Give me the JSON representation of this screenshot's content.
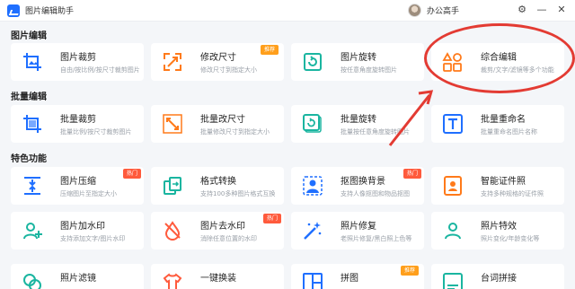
{
  "app": {
    "title": "图片编辑助手",
    "user_name": "办公高手"
  },
  "window": {
    "settings": "⚙",
    "minimize": "—",
    "close": "✕"
  },
  "sections": {
    "edit": "图片编辑",
    "batch": "批量编辑",
    "features": "特色功能"
  },
  "cards": {
    "crop": {
      "name": "图片裁剪",
      "desc": "自由/按比例/按尺寸裁剪图片"
    },
    "resize": {
      "name": "修改尺寸",
      "desc": "修改尺寸到指定大小",
      "badge": "推荐"
    },
    "rotate": {
      "name": "图片旋转",
      "desc": "按任意角度旋转图片"
    },
    "combo": {
      "name": "综合编辑",
      "desc": "裁剪/文字/滤镜等多个功能"
    },
    "batch_crop": {
      "name": "批量裁剪",
      "desc": "批量比例/按尺寸裁剪图片"
    },
    "batch_resize": {
      "name": "批量改尺寸",
      "desc": "批量修改尺寸到指定大小"
    },
    "batch_rotate": {
      "name": "批量旋转",
      "desc": "批量按任意角度旋转图片"
    },
    "batch_rename": {
      "name": "批量重命名",
      "desc": "批量重命名图片名称"
    },
    "compress": {
      "name": "图片压缩",
      "desc": "压缩图片至指定大小",
      "badge": "热门"
    },
    "format": {
      "name": "格式转换",
      "desc": "支持100多种图片格式互换"
    },
    "cutout": {
      "name": "抠图换背景",
      "desc": "支持人像抠图和物品抠图",
      "badge": "热门"
    },
    "id_photo": {
      "name": "智能证件照",
      "desc": "支持多种规格的证件照"
    },
    "watermark_add": {
      "name": "图片加水印",
      "desc": "支持添加文字/图片水印"
    },
    "watermark_remove": {
      "name": "图片去水印",
      "desc": "消除任意位置的水印",
      "badge": "热门"
    },
    "repair": {
      "name": "照片修复",
      "desc": "老照片修复/黑白照上色等"
    },
    "effects": {
      "name": "照片特效",
      "desc": "照片变化/年龄变化等"
    },
    "filter": {
      "name": "照片滤镜",
      "desc": ""
    },
    "outfit": {
      "name": "一键换装",
      "desc": ""
    },
    "puzzle": {
      "name": "拼图",
      "desc": "",
      "badge": "推荐"
    },
    "lines": {
      "name": "台词拼接",
      "desc": ""
    }
  },
  "colors": {
    "accent": "#1f6fff",
    "teal": "#1ab5a0",
    "orange": "#ff7a1a",
    "red_mark": "#e33b33"
  }
}
